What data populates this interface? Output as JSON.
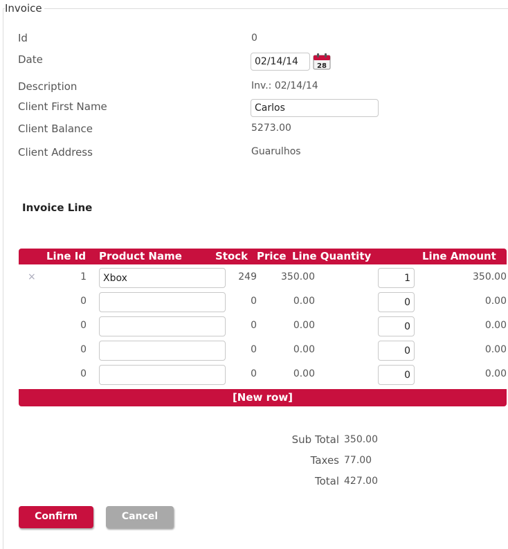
{
  "form": {
    "legend": "Invoice",
    "fields": {
      "id": {
        "label": "Id",
        "value": "0"
      },
      "date": {
        "label": "Date",
        "value": "02/14/14",
        "calendar_day": "28"
      },
      "description": {
        "label": "Description",
        "value": "Inv.: 02/14/14"
      },
      "client_first_name": {
        "label": "Client First Name",
        "value": "Carlos"
      },
      "client_balance": {
        "label": "Client Balance",
        "value": "5273.00"
      },
      "client_address": {
        "label": "Client Address",
        "value": "Guarulhos"
      }
    }
  },
  "lines": {
    "title": "Invoice Line",
    "columns": {
      "line_id": "Line Id",
      "product_name": "Product Name",
      "stock": "Stock",
      "price": "Price",
      "line_quantity": "Line Quantity",
      "line_amount": "Line Amount"
    },
    "rows": [
      {
        "delete": "×",
        "line_id": "1",
        "product_name": "Xbox",
        "stock": "249",
        "price": "350.00",
        "quantity": "1",
        "amount": "350.00"
      },
      {
        "delete": "",
        "line_id": "0",
        "product_name": "",
        "stock": "0",
        "price": "0.00",
        "quantity": "0",
        "amount": "0.00"
      },
      {
        "delete": "",
        "line_id": "0",
        "product_name": "",
        "stock": "0",
        "price": "0.00",
        "quantity": "0",
        "amount": "0.00"
      },
      {
        "delete": "",
        "line_id": "0",
        "product_name": "",
        "stock": "0",
        "price": "0.00",
        "quantity": "0",
        "amount": "0.00"
      },
      {
        "delete": "",
        "line_id": "0",
        "product_name": "",
        "stock": "0",
        "price": "0.00",
        "quantity": "0",
        "amount": "0.00"
      }
    ],
    "new_row_label": "[New row]"
  },
  "totals": {
    "sub_total": {
      "label": "Sub Total",
      "value": "350.00"
    },
    "taxes": {
      "label": "Taxes",
      "value": "77.00"
    },
    "total": {
      "label": "Total",
      "value": "427.00"
    }
  },
  "actions": {
    "confirm": "Confirm",
    "cancel": "Cancel"
  },
  "colors": {
    "accent": "#c8103e",
    "cancel_button": "#a9a9a9"
  },
  "icons": {
    "calendar": "calendar-icon",
    "delete": "delete-row-icon"
  }
}
